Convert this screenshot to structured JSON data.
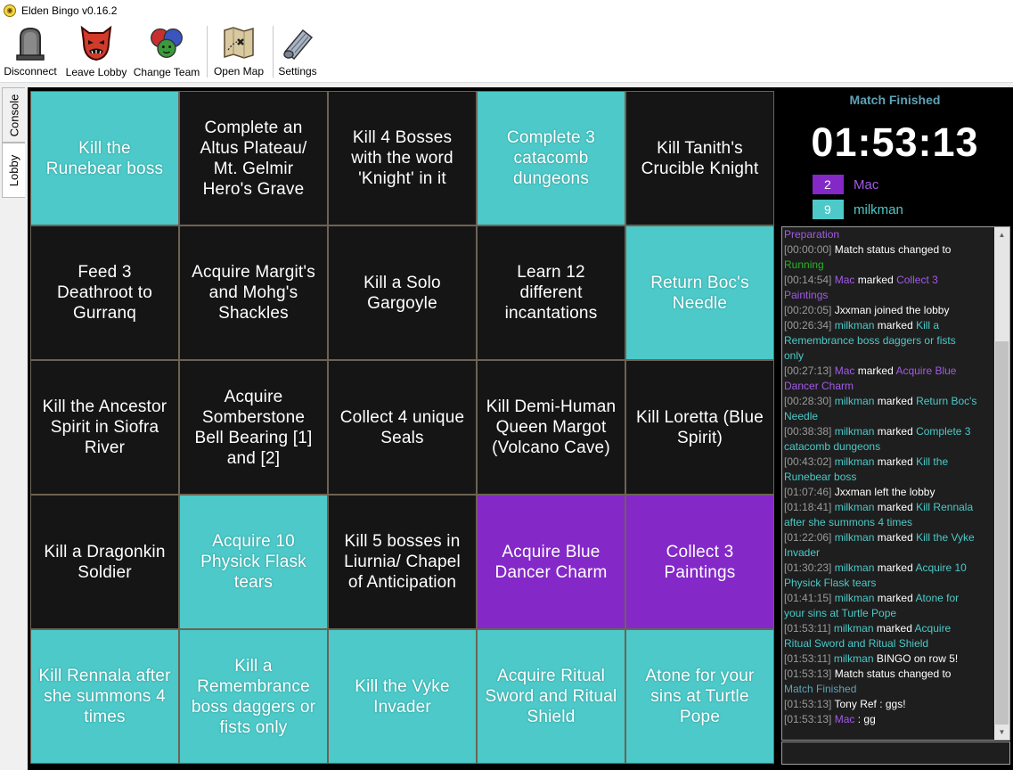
{
  "window": {
    "title": "Elden Bingo v0.16.2"
  },
  "toolbar": {
    "disconnect": "Disconnect",
    "leave_lobby": "Leave Lobby",
    "change_team": "Change Team",
    "open_map": "Open Map",
    "settings": "Settings"
  },
  "tabs": {
    "console": "Console",
    "lobby": "Lobby"
  },
  "colors": {
    "teal": "#4cc9c8",
    "purple": "#8428c8",
    "none": "#151515"
  },
  "board": [
    {
      "text": "Kill the Runebear boss",
      "team": "teal"
    },
    {
      "text": "Complete an Altus Plateau/ Mt. Gelmir Hero's Grave",
      "team": "none"
    },
    {
      "text": "Kill 4 Bosses with the word 'Knight' in it",
      "team": "none"
    },
    {
      "text": "Complete 3 catacomb dungeons",
      "team": "teal"
    },
    {
      "text": "Kill Tanith's Crucible Knight",
      "team": "none"
    },
    {
      "text": "Feed 3 Deathroot to Gurranq",
      "team": "none"
    },
    {
      "text": "Acquire Margit's and Mohg's Shackles",
      "team": "none"
    },
    {
      "text": "Kill a Solo Gargoyle",
      "team": "none"
    },
    {
      "text": "Learn 12 different incantations",
      "team": "none"
    },
    {
      "text": "Return Boc's Needle",
      "team": "teal"
    },
    {
      "text": "Kill the Ancestor Spirit in Siofra River",
      "team": "none"
    },
    {
      "text": "Acquire Somberstone Bell Bearing [1] and [2]",
      "team": "none"
    },
    {
      "text": "Collect 4 unique Seals",
      "team": "none"
    },
    {
      "text": "Kill Demi-Human Queen Margot (Volcano Cave)",
      "team": "none"
    },
    {
      "text": "Kill Loretta (Blue Spirit)",
      "team": "none"
    },
    {
      "text": "Kill a Dragonkin Soldier",
      "team": "none"
    },
    {
      "text": "Acquire 10 Physick Flask tears",
      "team": "teal"
    },
    {
      "text": "Kill 5 bosses in Liurnia/ Chapel of Anticipation",
      "team": "none"
    },
    {
      "text": "Acquire Blue Dancer Charm",
      "team": "purple"
    },
    {
      "text": "Collect 3 Paintings",
      "team": "purple"
    },
    {
      "text": "Kill Rennala after she summons 4 times",
      "team": "teal"
    },
    {
      "text": "Kill a Remembrance boss daggers or fists only",
      "team": "teal"
    },
    {
      "text": "Kill the Vyke Invader",
      "team": "teal"
    },
    {
      "text": "Acquire Ritual Sword and Ritual Shield",
      "team": "teal"
    },
    {
      "text": "Atone for your sins at Turtle Pope",
      "team": "teal"
    }
  ],
  "match": {
    "status": "Match Finished",
    "timer": "01:53:13"
  },
  "teams": [
    {
      "score": "2",
      "name": "Mac",
      "color": "#8428c8",
      "name_color": "#a25ae8"
    },
    {
      "score": "9",
      "name": "milkman",
      "color": "#4cc9c8",
      "name_color": "#4cc9c8"
    }
  ],
  "log": [
    [
      {
        "t": "Preparation",
        "c": "c-mac"
      }
    ],
    [
      {
        "t": "[00:00:00]",
        "c": "ts"
      },
      {
        "t": " Match status changed to "
      }
    ],
    [
      {
        "t": "Running",
        "c": "c-run"
      }
    ],
    [
      {
        "t": "[00:14:54]",
        "c": "ts"
      },
      {
        "t": " Mac",
        "c": "c-mac"
      },
      {
        "t": " marked "
      },
      {
        "t": "Collect 3",
        "c": "c-mac"
      }
    ],
    [
      {
        "t": "Paintings",
        "c": "c-mac"
      }
    ],
    [
      {
        "t": "[00:20:05]",
        "c": "ts"
      },
      {
        "t": " Jxxman joined the lobby"
      }
    ],
    [
      {
        "t": "[00:26:34]",
        "c": "ts"
      },
      {
        "t": " milkman",
        "c": "c-milk"
      },
      {
        "t": " marked "
      },
      {
        "t": "Kill a",
        "c": "c-milk"
      }
    ],
    [
      {
        "t": "Remembrance boss daggers or fists",
        "c": "c-milk"
      }
    ],
    [
      {
        "t": "only",
        "c": "c-milk"
      }
    ],
    [
      {
        "t": "[00:27:13]",
        "c": "ts"
      },
      {
        "t": " Mac",
        "c": "c-mac"
      },
      {
        "t": " marked "
      },
      {
        "t": "Acquire Blue",
        "c": "c-mac"
      }
    ],
    [
      {
        "t": "Dancer Charm",
        "c": "c-mac"
      }
    ],
    [
      {
        "t": "[00:28:30]",
        "c": "ts"
      },
      {
        "t": " milkman",
        "c": "c-milk"
      },
      {
        "t": " marked "
      },
      {
        "t": "Return Boc's",
        "c": "c-milk"
      }
    ],
    [
      {
        "t": "Needle",
        "c": "c-milk"
      }
    ],
    [
      {
        "t": "[00:38:38]",
        "c": "ts"
      },
      {
        "t": " milkman",
        "c": "c-milk"
      },
      {
        "t": " marked "
      },
      {
        "t": "Complete 3",
        "c": "c-milk"
      }
    ],
    [
      {
        "t": "catacomb dungeons",
        "c": "c-milk"
      }
    ],
    [
      {
        "t": "[00:43:02]",
        "c": "ts"
      },
      {
        "t": " milkman",
        "c": "c-milk"
      },
      {
        "t": " marked "
      },
      {
        "t": "Kill the",
        "c": "c-milk"
      }
    ],
    [
      {
        "t": "Runebear boss",
        "c": "c-milk"
      }
    ],
    [
      {
        "t": "[01:07:46]",
        "c": "ts"
      },
      {
        "t": " Jxxman left the lobby"
      }
    ],
    [
      {
        "t": "[01:18:41]",
        "c": "ts"
      },
      {
        "t": " milkman",
        "c": "c-milk"
      },
      {
        "t": " marked "
      },
      {
        "t": "Kill Rennala",
        "c": "c-milk"
      }
    ],
    [
      {
        "t": "after she summons 4 times",
        "c": "c-milk"
      }
    ],
    [
      {
        "t": "[01:22:06]",
        "c": "ts"
      },
      {
        "t": " milkman",
        "c": "c-milk"
      },
      {
        "t": " marked "
      },
      {
        "t": "Kill the Vyke",
        "c": "c-milk"
      }
    ],
    [
      {
        "t": "Invader",
        "c": "c-milk"
      }
    ],
    [
      {
        "t": "[01:30:23]",
        "c": "ts"
      },
      {
        "t": " milkman",
        "c": "c-milk"
      },
      {
        "t": " marked "
      },
      {
        "t": "Acquire 10",
        "c": "c-milk"
      }
    ],
    [
      {
        "t": "Physick Flask tears",
        "c": "c-milk"
      }
    ],
    [
      {
        "t": "[01:41:15]",
        "c": "ts"
      },
      {
        "t": " milkman",
        "c": "c-milk"
      },
      {
        "t": " marked "
      },
      {
        "t": "Atone for",
        "c": "c-milk"
      }
    ],
    [
      {
        "t": "your sins at Turtle Pope",
        "c": "c-milk"
      }
    ],
    [
      {
        "t": "[01:53:11]",
        "c": "ts"
      },
      {
        "t": " milkman",
        "c": "c-milk"
      },
      {
        "t": " marked "
      },
      {
        "t": "Acquire",
        "c": "c-milk"
      }
    ],
    [
      {
        "t": "Ritual Sword and Ritual Shield",
        "c": "c-milk"
      }
    ],
    [
      {
        "t": "[01:53:11]",
        "c": "ts"
      },
      {
        "t": " milkman",
        "c": "c-milk"
      },
      {
        "t": " BINGO on row 5!"
      }
    ],
    [
      {
        "t": "[01:53:13]",
        "c": "ts"
      },
      {
        "t": " Match status changed to"
      }
    ],
    [
      {
        "t": "Match Finished",
        "c": "c-fin"
      }
    ],
    [
      {
        "t": "[01:53:13]",
        "c": "ts"
      },
      {
        "t": " Tony Ref : ggs!"
      }
    ],
    [
      {
        "t": "[01:53:13]",
        "c": "ts"
      },
      {
        "t": " Mac",
        "c": "c-mac"
      },
      {
        "t": " : gg"
      }
    ]
  ],
  "chat_input": {
    "value": ""
  }
}
